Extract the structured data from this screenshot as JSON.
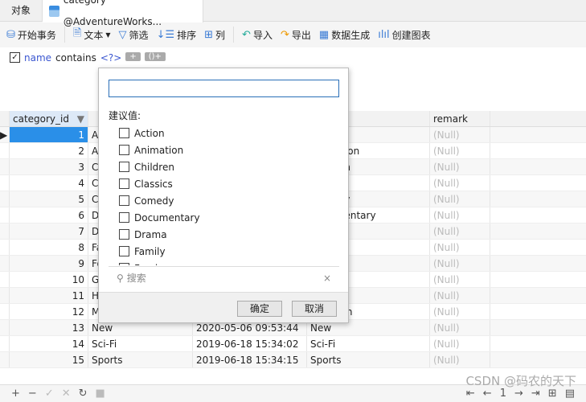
{
  "tabs": [
    {
      "label": "对象"
    },
    {
      "label": "category @AdventureWorks..."
    }
  ],
  "toolbar": {
    "begin": "开始事务",
    "text": "文本",
    "filter": "筛选",
    "sort": "排序",
    "columns": "列",
    "import": "导入",
    "export": "导出",
    "datagen": "数据生成",
    "chart": "创建图表"
  },
  "filter": {
    "field": "name",
    "op": "contains",
    "value": "<?>",
    "add": "+",
    "group": "()+"
  },
  "columns": [
    "category_id",
    "",
    "",
    "",
    "remark"
  ],
  "rows": [
    [
      "1",
      "Action",
      "",
      "",
      "(Null)"
    ],
    [
      "2",
      "Animation",
      "",
      "Animation",
      "(Null)"
    ],
    [
      "3",
      "Children",
      "",
      "Children",
      "(Null)"
    ],
    [
      "4",
      "Classics",
      "",
      "",
      "(Null)"
    ],
    [
      "5",
      "Comedy",
      "",
      "Comedy",
      "(Null)"
    ],
    [
      "6",
      "Documentary",
      "",
      "Documentary",
      "(Null)"
    ],
    [
      "7",
      "Drama",
      "",
      "",
      "(Null)"
    ],
    [
      "8",
      "Family",
      "",
      "",
      "(Null)"
    ],
    [
      "9",
      "Foreign",
      "",
      "",
      "(Null)"
    ],
    [
      "10",
      "Games",
      "",
      "",
      "(Null)"
    ],
    [
      "11",
      "Horror",
      "",
      "",
      "(Null)"
    ],
    [
      "12",
      "Music",
      "",
      "Musician",
      "(Null)"
    ],
    [
      "13",
      "New",
      "2020-05-06 09:53:44",
      "New",
      "(Null)"
    ],
    [
      "14",
      "Sci-Fi",
      "2019-06-18 15:34:02",
      "Sci-Fi",
      "(Null)"
    ],
    [
      "15",
      "Sports",
      "2019-06-18 15:34:15",
      "Sports",
      "(Null)"
    ]
  ],
  "popup": {
    "input_value": "",
    "suggest_label": "建议值:",
    "options": [
      "Action",
      "Animation",
      "Children",
      "Classics",
      "Comedy",
      "Documentary",
      "Drama",
      "Family",
      "Foreign"
    ],
    "search_placeholder": "搜索",
    "ok": "确定",
    "cancel": "取消"
  },
  "status": {
    "page": "1"
  },
  "watermark": "CSDN @码农的天下"
}
